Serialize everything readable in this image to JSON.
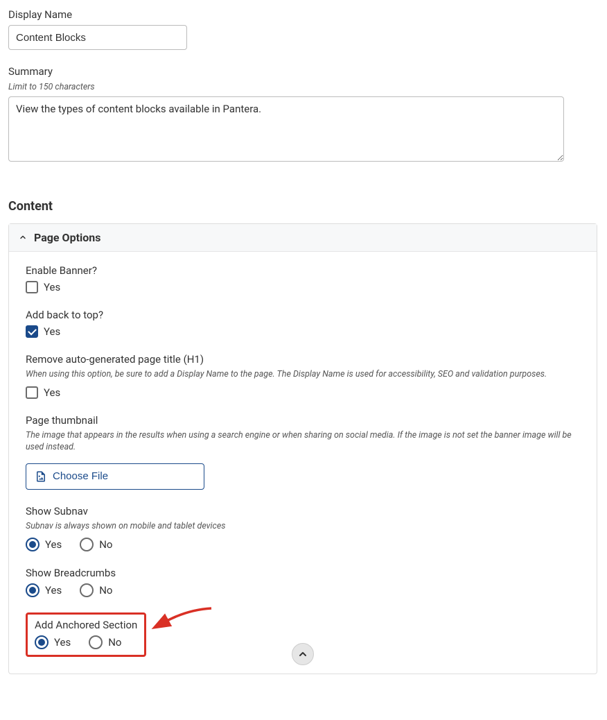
{
  "form": {
    "display_name_label": "Display Name",
    "display_name_value": "Content Blocks",
    "summary_label": "Summary",
    "summary_hint": "Limit to 150 characters",
    "summary_value": "View the types of content blocks available in Pantera."
  },
  "content": {
    "section_title": "Content",
    "panel_title": "Page Options",
    "options": {
      "enable_banner": {
        "label": "Enable Banner?",
        "choice": "Yes"
      },
      "back_to_top": {
        "label": "Add back to top?",
        "choice": "Yes"
      },
      "remove_h1": {
        "label": "Remove auto-generated page title (H1)",
        "hint": "When using this option, be sure to add a Display Name to the page. The Display Name is used for accessibility, SEO and validation purposes.",
        "choice": "Yes"
      },
      "thumbnail": {
        "label": "Page thumbnail",
        "hint": "The image that appears in the results when using a search engine or when sharing on social media. If the image is not set the banner image will be used instead.",
        "button": "Choose File"
      },
      "subnav": {
        "label": "Show Subnav",
        "hint": "Subnav is always shown on mobile and tablet devices",
        "yes": "Yes",
        "no": "No"
      },
      "breadcrumbs": {
        "label": "Show Breadcrumbs",
        "yes": "Yes",
        "no": "No"
      },
      "anchored": {
        "label": "Add Anchored Section",
        "yes": "Yes",
        "no": "No"
      }
    }
  }
}
